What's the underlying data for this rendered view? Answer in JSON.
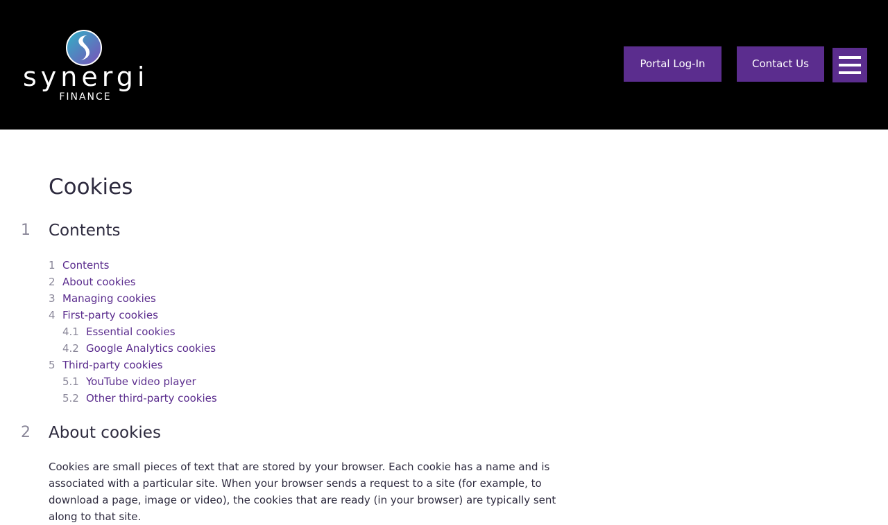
{
  "header": {
    "logo_word": "synergi",
    "logo_sub": "FINANCE",
    "portal_label": "Portal Log-In",
    "contact_label": "Contact Us",
    "colors": {
      "header_bg": "#000000",
      "accent": "#5b2d8e",
      "logo_teal": "#2fb3c6",
      "logo_purple": "#7b4fb8"
    }
  },
  "page": {
    "title": "Cookies"
  },
  "sections": [
    {
      "num": "1",
      "heading": "Contents"
    },
    {
      "num": "2",
      "heading": "About cookies"
    }
  ],
  "toc": [
    {
      "num": "1",
      "label": "Contents"
    },
    {
      "num": "2",
      "label": "About cookies"
    },
    {
      "num": "3",
      "label": "Managing cookies"
    },
    {
      "num": "4",
      "label": "First-party cookies"
    },
    {
      "num": "4.1",
      "label": "Essential cookies"
    },
    {
      "num": "4.2",
      "label": "Google Analytics cookies"
    },
    {
      "num": "5",
      "label": "Third-party cookies"
    },
    {
      "num": "5.1",
      "label": "YouTube video player"
    },
    {
      "num": "5.2",
      "label": "Other third-party cookies"
    }
  ],
  "about": {
    "paragraph": "Cookies are small pieces of text that are stored by your browser. Each cookie has a name and is associated with a particular site. When your browser sends a request to a site (for example, to download a page, image or video), the cookies that are ready (in your browser) are typically sent along to that site."
  }
}
